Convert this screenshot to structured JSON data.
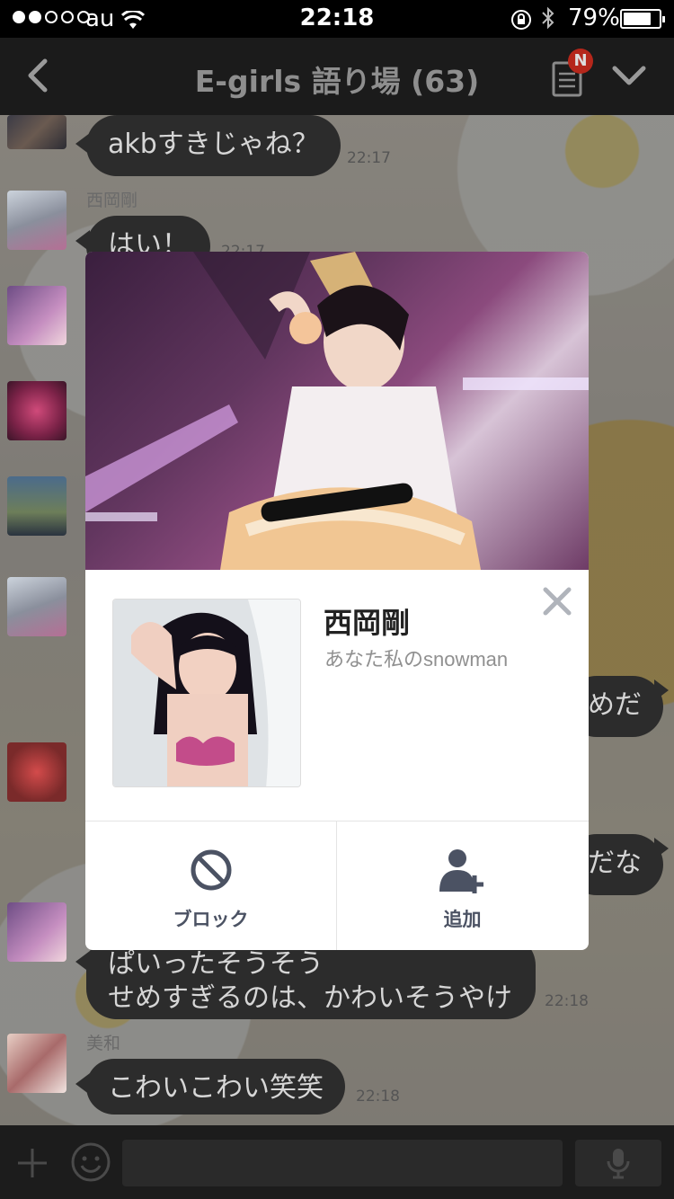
{
  "status_bar": {
    "carrier": "au",
    "time": "22:18",
    "battery_percent": "79%",
    "battery_level": 0.79,
    "signal_bars_filled": 2,
    "signal_bars_total": 5
  },
  "nav": {
    "title": "E-girls  語り場 (63)",
    "notes_badge": "N",
    "icons": [
      "back-chevron-icon",
      "notes-icon",
      "chevron-down-icon"
    ]
  },
  "chat": {
    "messages": [
      {
        "text": "akbすきじゃね？",
        "time": "22:17"
      },
      {
        "sender": "西岡剛",
        "text": "はい！",
        "time": "22:17"
      },
      {
        "text": "めだ"
      },
      {
        "text": "だな"
      },
      {
        "text": "ぱいったそうそう\nせめすぎるのは、かわいそうやけ",
        "time": "22:18"
      },
      {
        "sender": "美和",
        "text": "こわいこわい笑笑",
        "time": "22:18"
      }
    ]
  },
  "profile_popup": {
    "name": "西岡剛",
    "status_message": "あなた私のsnowman",
    "actions": [
      {
        "label": "ブロック",
        "icon": "block-icon"
      },
      {
        "label": "追加",
        "icon": "add-friend-icon"
      }
    ],
    "close_icon": "close-icon"
  },
  "input_bar": {
    "icons": [
      "plus-icon",
      "emoji-icon",
      "microphone-icon"
    ]
  },
  "colors": {
    "badge": "#b5271b",
    "bubble": "#2c2c2c",
    "action_label": "#4b5263"
  }
}
